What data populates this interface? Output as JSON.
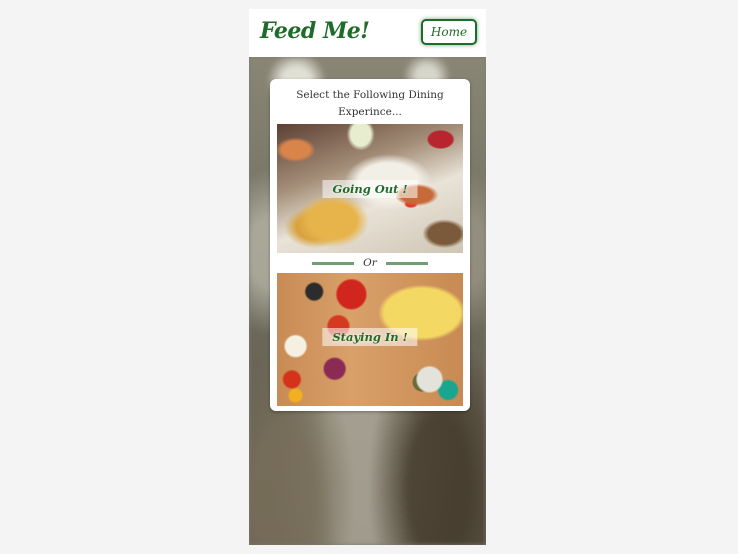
{
  "header": {
    "brand": "Feed Me!",
    "home_label": "Home"
  },
  "card": {
    "prompt": "Select the Following Dining Experince...",
    "options": [
      {
        "label": "Going Out !"
      },
      {
        "label": "Staying In !"
      }
    ],
    "divider_text": "Or"
  },
  "colors": {
    "brand_green": "#1f6b2a",
    "divider_green": "#6f9f72",
    "card_bg": "#ffffff"
  }
}
